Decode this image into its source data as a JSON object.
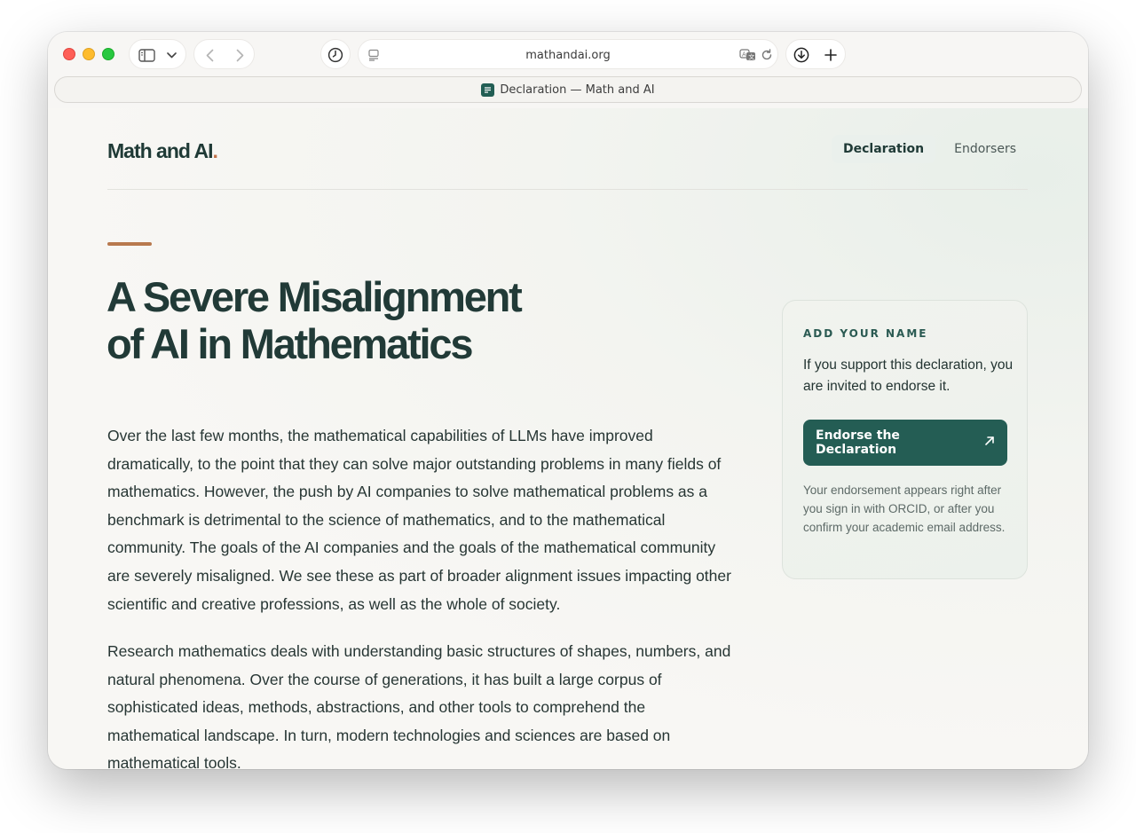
{
  "browser": {
    "url": "mathandai.org",
    "tab_title": "Declaration — Math and AI"
  },
  "site": {
    "brand": "Math and AI",
    "brand_dot": ".",
    "nav": [
      {
        "label": "Declaration",
        "active": true
      },
      {
        "label": "Endorsers",
        "active": false
      }
    ]
  },
  "hero": {
    "title_line1": "A Severe Misalignment",
    "title_line2": "of AI in Mathematics"
  },
  "body": {
    "paragraph1": "Over the last few months, the mathematical capabilities of LLMs have improved dramatically, to the point that they can solve major outstanding problems in many fields of mathematics. However, the push by AI companies to solve mathematical problems as a benchmark is detrimental to the science of mathematics, and to the mathematical community. The goals of the AI companies and the goals of the mathematical community are severely misaligned. We see these as part of broader alignment issues impacting other scientific and creative professions, as well as the whole of society.",
    "paragraph2": "Research mathematics deals with understanding basic structures of shapes, numbers, and natural phenomena. Over the course of generations, it has built a large corpus of sophisticated ideas, methods, abstractions, and other tools to comprehend the mathematical landscape. In turn, modern technologies and sciences are based on mathematical tools."
  },
  "card": {
    "eyebrow": "ADD YOUR NAME",
    "text": "If you support this declaration, you are invited to endorse it.",
    "button_label": "Endorse the Declaration",
    "note": "Your endorsement appears right after you sign in with ORCID, or after you confirm your academic email address."
  },
  "colors": {
    "brand_green": "#245d54",
    "accent_copper": "#b8794e",
    "heading": "#213a37"
  }
}
